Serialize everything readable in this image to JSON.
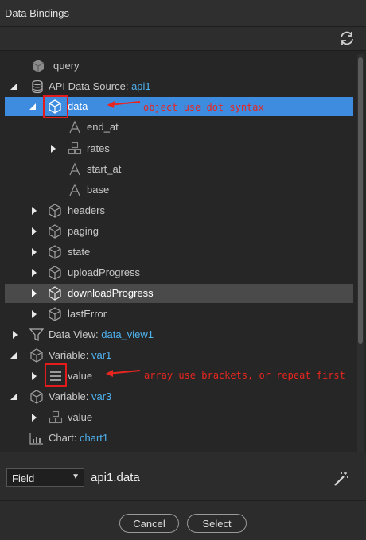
{
  "window": {
    "title": "Data Bindings"
  },
  "tree": {
    "query": "query",
    "api_source": {
      "key": "API Data Source: ",
      "value": "api1"
    },
    "data": "data",
    "end_at": "end_at",
    "rates": "rates",
    "start_at": "start_at",
    "base": "base",
    "headers": "headers",
    "paging": "paging",
    "state": "state",
    "uploadProgress": "uploadProgress",
    "downloadProgress": "downloadProgress",
    "lastError": "lastError",
    "data_view": {
      "key": "Data View: ",
      "value": "data_view1"
    },
    "var1": {
      "key": "Variable: ",
      "value": "var1"
    },
    "var1_value": "value",
    "var3": {
      "key": "Variable: ",
      "value": "var3"
    },
    "var3_value": "value",
    "chart": {
      "key": "Chart: ",
      "value": "chart1"
    }
  },
  "annotations": {
    "object": "object use dot syntax",
    "array": "array use brackets, or repeat first"
  },
  "bottom": {
    "type_selected": "Field",
    "expression": "api1.data"
  },
  "buttons": {
    "cancel": "Cancel",
    "select": "Select"
  },
  "colors": {
    "accent": "#3d8ce0",
    "link": "#4fb3f0",
    "annotation": "#e8261f"
  }
}
